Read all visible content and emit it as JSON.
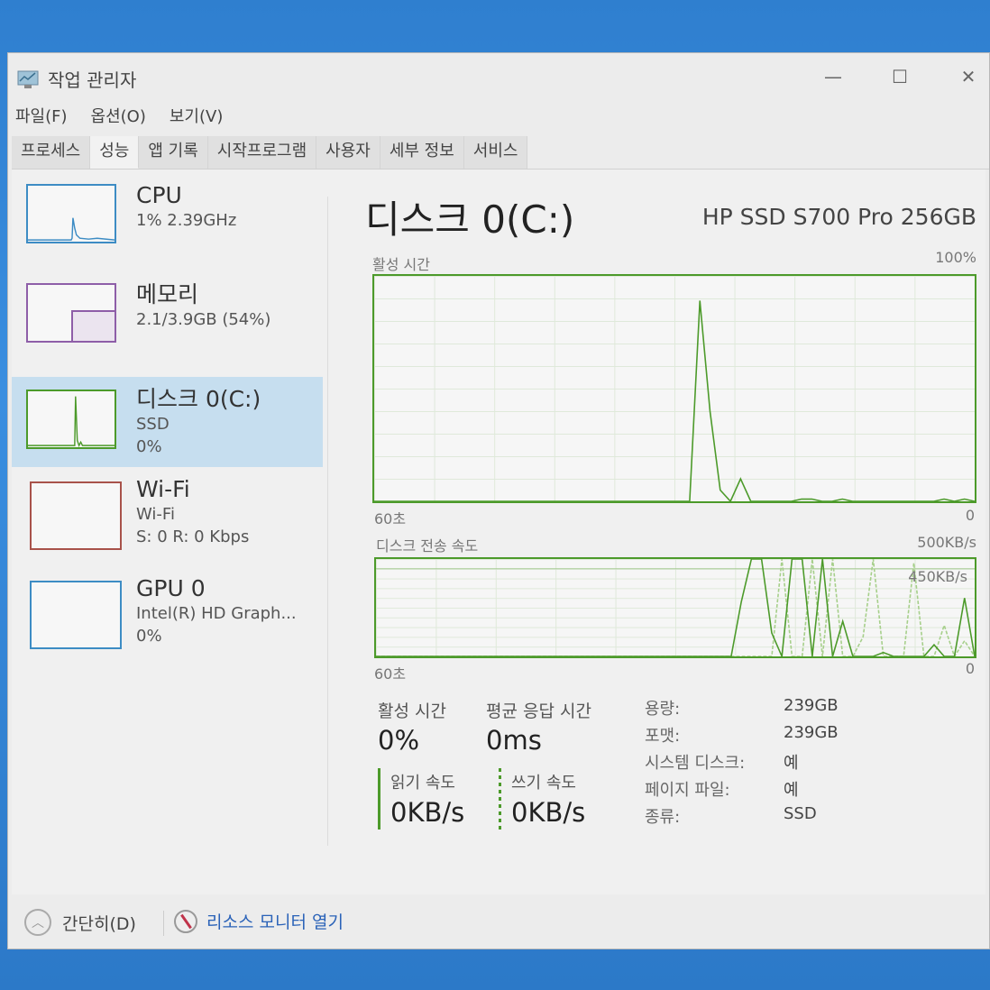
{
  "window": {
    "title": "작업 관리자",
    "controls": {
      "minimize": "—",
      "maximize": "☐",
      "close": "✕"
    }
  },
  "menu": [
    "파일(F)",
    "옵션(O)",
    "보기(V)"
  ],
  "tabs": [
    {
      "label": "프로세스",
      "active": false
    },
    {
      "label": "성능",
      "active": true
    },
    {
      "label": "앱 기록",
      "active": false
    },
    {
      "label": "시작프로그램",
      "active": false
    },
    {
      "label": "사용자",
      "active": false
    },
    {
      "label": "세부 정보",
      "active": false
    },
    {
      "label": "서비스",
      "active": false
    }
  ],
  "sidebar": {
    "items": [
      {
        "name": "CPU",
        "line1": "1% 2.39GHz",
        "line2": "",
        "color": "#3d8cc4"
      },
      {
        "name": "메모리",
        "line1": "2.1/3.9GB (54%)",
        "line2": "",
        "color": "#8e5ea8"
      },
      {
        "name": "디스크 0(C:)",
        "line1": "SSD",
        "line2": "0%",
        "color": "#4c9a2a",
        "selected": true
      },
      {
        "name": "Wi-Fi",
        "line1": "Wi-Fi",
        "line2": "S: 0 R: 0 Kbps",
        "color": "#a8524a"
      },
      {
        "name": "GPU 0",
        "line1": "Intel(R) HD Graph...",
        "line2": "0%",
        "color": "#3d8cc4"
      }
    ]
  },
  "main": {
    "title": "디스크 0(C:)",
    "model": "HP SSD S700 Pro 256GB",
    "active_time_graph": {
      "label": "활성 시간",
      "max_label": "100%",
      "x_left": "60초",
      "x_right": "0"
    },
    "transfer_graph": {
      "label": "디스크 전송 속도",
      "max_label": "500KB/s",
      "ref_label": "450KB/s",
      "x_left": "60초",
      "x_right": "0"
    },
    "stats": {
      "active_time_label": "활성 시간",
      "active_time_value": "0%",
      "avg_response_label": "평균 응답 시간",
      "avg_response_value": "0ms",
      "read_label": "읽기 속도",
      "read_value": "0KB/s",
      "write_label": "쓰기 속도",
      "write_value": "0KB/s"
    },
    "properties": [
      {
        "label": "용량:",
        "value": "239GB"
      },
      {
        "label": "포맷:",
        "value": "239GB"
      },
      {
        "label": "시스템 디스크:",
        "value": "예"
      },
      {
        "label": "페이지 파일:",
        "value": "예"
      },
      {
        "label": "종류:",
        "value": "SSD"
      }
    ]
  },
  "footer": {
    "fewer_details": "간단히(D)",
    "resource_monitor": "리소스 모니터 열기"
  },
  "chart_data": [
    {
      "type": "line",
      "title": "활성 시간",
      "xlabel": "60초 → 0",
      "ylim": [
        0,
        100
      ],
      "x_range": [
        60,
        0
      ],
      "series": [
        {
          "name": "active_time_pct",
          "values": [
            0,
            0,
            0,
            0,
            0,
            0,
            0,
            0,
            0,
            0,
            0,
            0,
            0,
            0,
            0,
            0,
            0,
            0,
            0,
            0,
            0,
            0,
            0,
            0,
            0,
            0,
            0,
            0,
            0,
            0,
            0,
            0,
            89,
            40,
            5,
            0,
            10,
            0,
            0,
            0,
            0,
            0,
            1,
            1,
            0,
            0,
            1,
            0,
            0,
            0,
            0,
            0,
            0,
            0,
            0,
            0,
            1,
            0,
            1,
            0
          ]
        }
      ]
    },
    {
      "type": "line",
      "title": "디스크 전송 속도",
      "ylim": [
        0,
        500
      ],
      "reference_line": 450,
      "series": [
        {
          "name": "read",
          "values": [
            0,
            0,
            0,
            0,
            0,
            0,
            0,
            0,
            0,
            0,
            0,
            0,
            0,
            0,
            0,
            0,
            0,
            0,
            0,
            0,
            0,
            0,
            0,
            0,
            0,
            0,
            0,
            0,
            0,
            0,
            0,
            0,
            0,
            0,
            0,
            0,
            280,
            500,
            500,
            120,
            0,
            500,
            500,
            0,
            500,
            0,
            180,
            0,
            0,
            0,
            20,
            0,
            0,
            0,
            0,
            60,
            0,
            0,
            300,
            0
          ]
        },
        {
          "name": "write",
          "values": [
            0,
            0,
            0,
            0,
            0,
            0,
            0,
            0,
            0,
            0,
            0,
            0,
            0,
            0,
            0,
            0,
            0,
            0,
            0,
            0,
            0,
            0,
            0,
            0,
            0,
            0,
            0,
            0,
            0,
            0,
            0,
            0,
            0,
            0,
            0,
            0,
            0,
            0,
            0,
            0,
            500,
            0,
            0,
            500,
            0,
            500,
            0,
            0,
            100,
            500,
            0,
            0,
            0,
            480,
            0,
            0,
            160,
            0,
            80,
            0
          ]
        }
      ]
    }
  ]
}
